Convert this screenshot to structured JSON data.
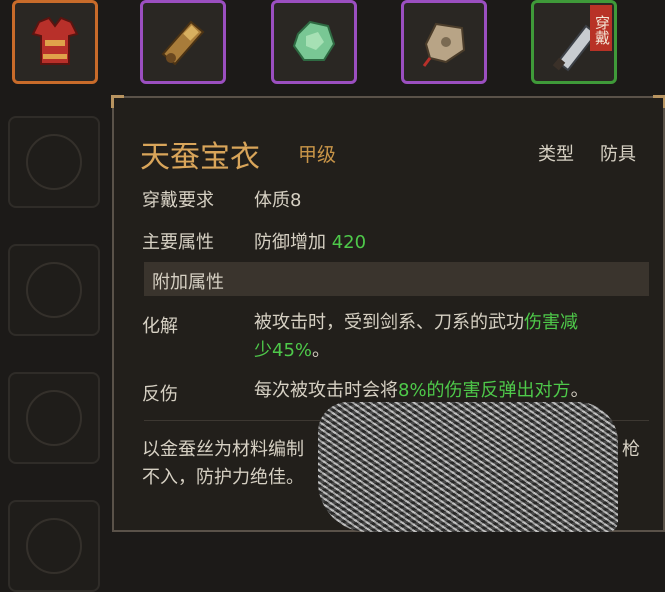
{
  "equipment_row": {
    "badge_text": "穿戴",
    "slots": [
      {
        "icon": "armor-icon",
        "quality": "orange"
      },
      {
        "icon": "scroll-icon",
        "quality": "purple"
      },
      {
        "icon": "jade-icon",
        "quality": "purple"
      },
      {
        "icon": "pouch-icon",
        "quality": "purple"
      },
      {
        "icon": "blade-icon",
        "quality": "green",
        "equipped": true
      }
    ]
  },
  "tooltip": {
    "name": "天蚕宝衣",
    "grade": "甲级",
    "type_label": "类型",
    "type_value": "防具",
    "requirement_label": "穿戴要求",
    "requirement_value": "体质8",
    "main_attr_label": "主要属性",
    "main_attr_text": "防御增加",
    "main_attr_value": "420",
    "extra_header": "附加属性",
    "traits": [
      {
        "name": "化解",
        "line1_text": "被攻击时，受到剑系、刀系的武功",
        "line1_green": "伤害减",
        "line2_green": "少45%",
        "line2_text": "。"
      },
      {
        "name": "反伤",
        "line1_text": "每次被攻击时会将",
        "line1_green": "8%的伤害反弹出对方",
        "line1_tail": "。"
      }
    ],
    "description_line1": "以金蚕丝为材料编制",
    "description_line1_tail": "枪",
    "description_line2": "不入，防护力绝佳。"
  }
}
